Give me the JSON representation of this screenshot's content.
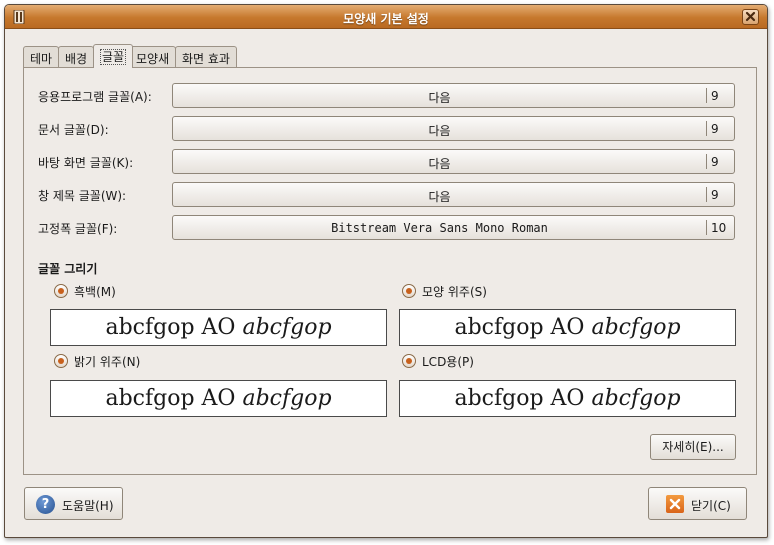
{
  "window": {
    "title": "모양새 기본 설정"
  },
  "tabs": [
    {
      "label": "테마"
    },
    {
      "label": "배경"
    },
    {
      "label": "글꼴"
    },
    {
      "label": "모양새"
    },
    {
      "label": "화면 효과"
    }
  ],
  "fonts": [
    {
      "label": "응용프로그램 글꼴(A):",
      "font": "다음",
      "size": "9"
    },
    {
      "label": "문서 글꼴(D):",
      "font": "다음",
      "size": "9"
    },
    {
      "label": "바탕 화면 글꼴(K):",
      "font": "다음",
      "size": "9"
    },
    {
      "label": "창 제목 글꼴(W):",
      "font": "다음",
      "size": "9"
    },
    {
      "label": "고정폭 글꼴(F):",
      "font": "Bitstream Vera Sans Mono Roman",
      "size": "10"
    }
  ],
  "rendering": {
    "title": "글꼴 그리기",
    "options": [
      {
        "label": "흑백(M)",
        "preview_regular": "abcfgop AO ",
        "preview_italic": "abcfgop"
      },
      {
        "label": "모양 위주(S)",
        "preview_regular": "abcfgop AO ",
        "preview_italic": "abcfgop"
      },
      {
        "label": "밝기 위주(N)",
        "preview_regular": "abcfgop AO ",
        "preview_italic": "abcfgop"
      },
      {
        "label": "LCD용(P)",
        "preview_regular": "abcfgop AO ",
        "preview_italic": "abcfgop"
      }
    ],
    "details_label": "자세히(E)..."
  },
  "buttons": {
    "help": "도움말(H)",
    "close": "닫기(C)"
  },
  "colors": {
    "titlebar": "#c6782d",
    "radio_dot": "#c8601c",
    "help_icon": "#25508f",
    "close_icon": "#d9641a"
  },
  "icons": {
    "app": "application-icon",
    "close": "close-icon",
    "help": "help-icon",
    "close_button": "close-x-icon",
    "radio": "radio-icon"
  }
}
